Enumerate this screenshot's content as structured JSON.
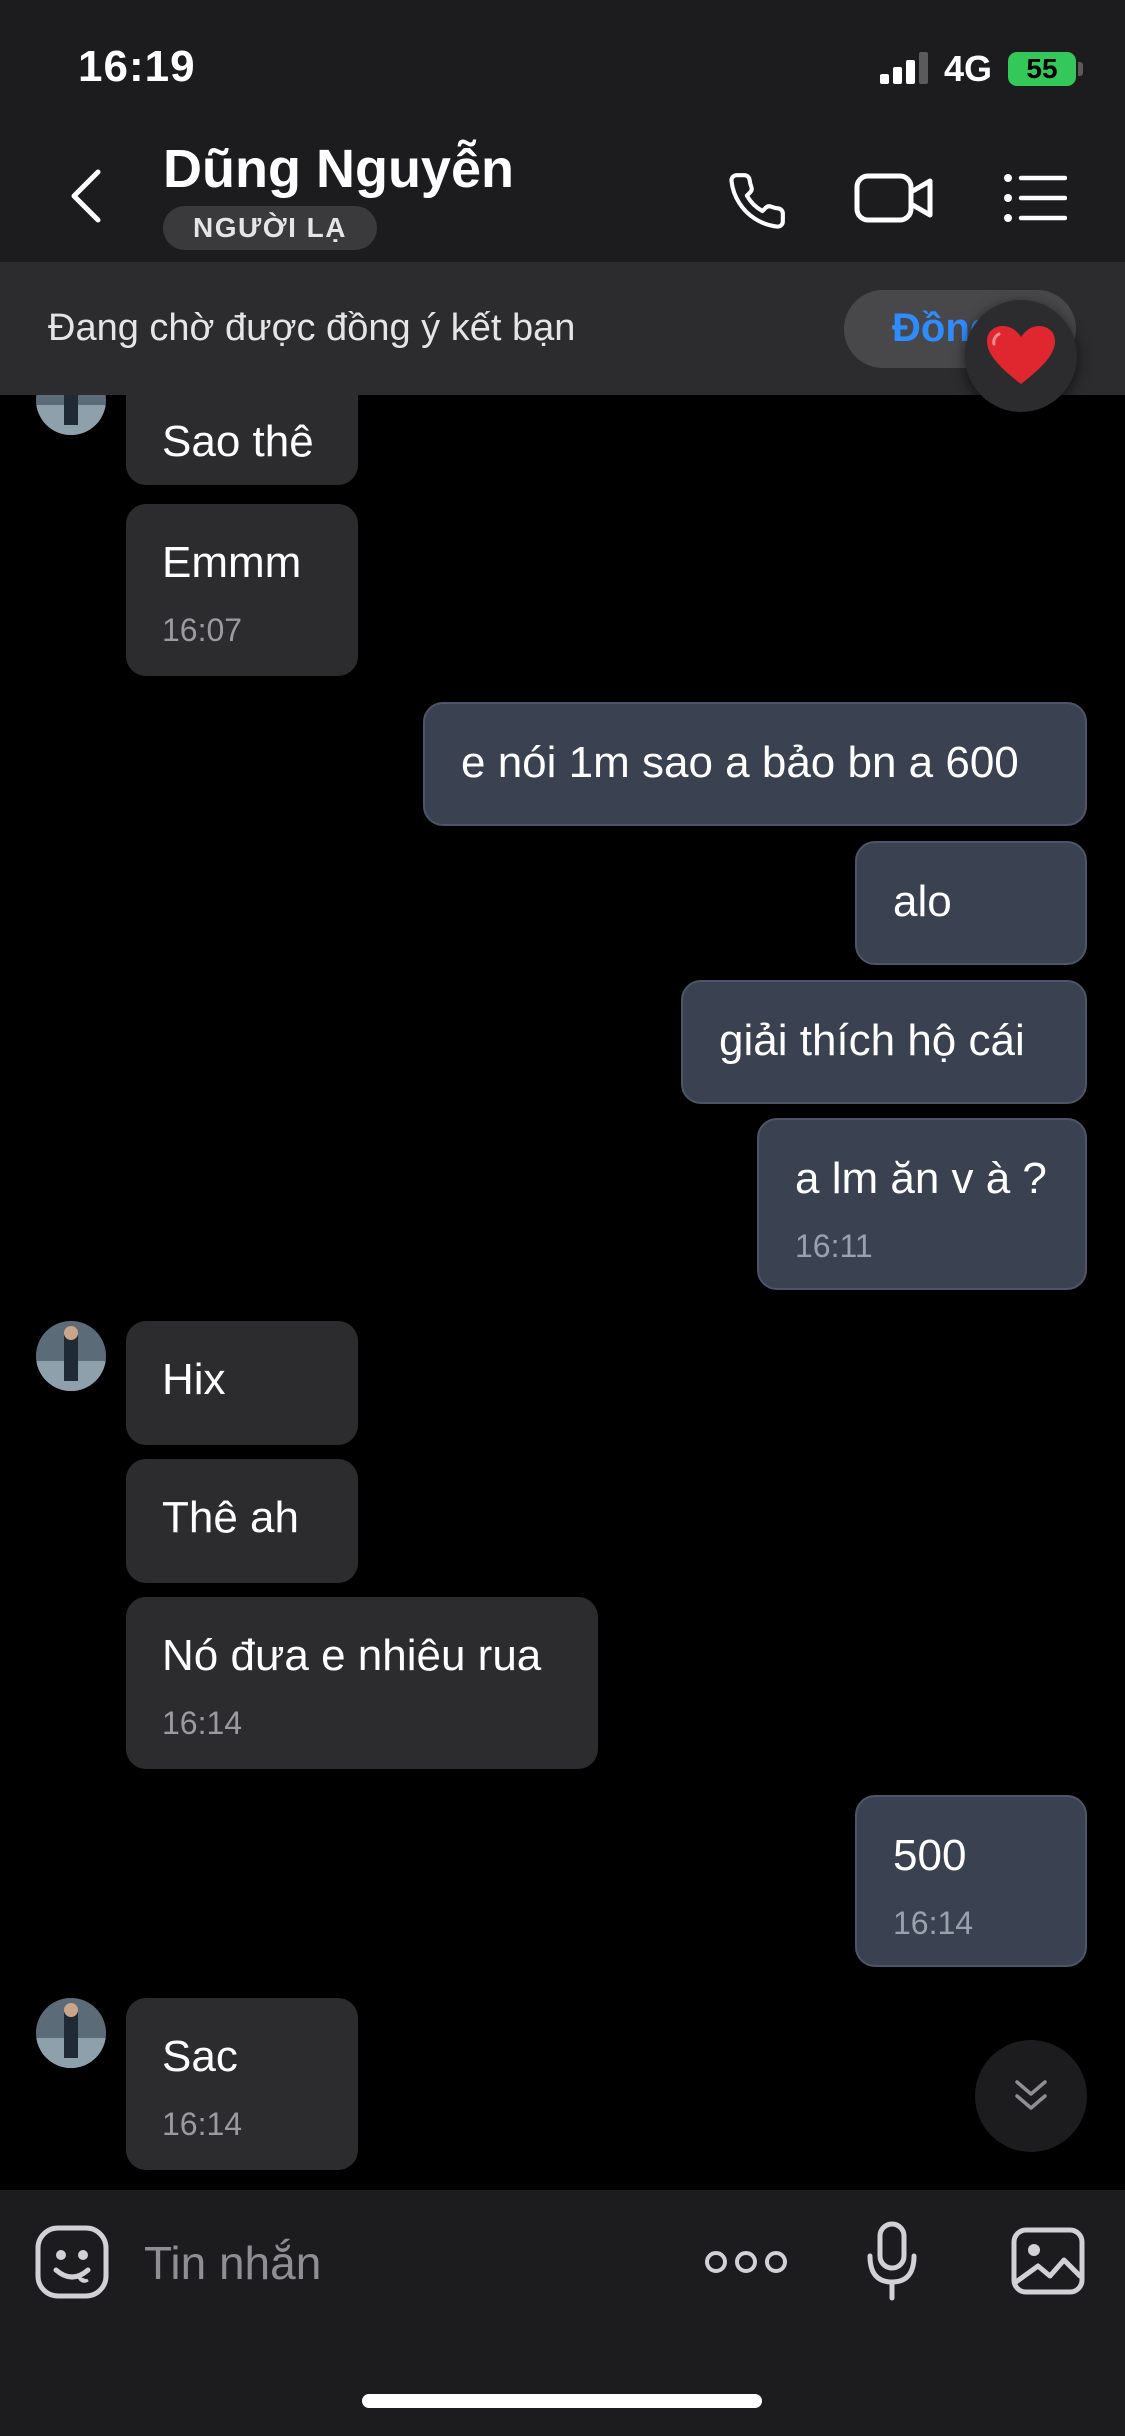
{
  "status_bar": {
    "time": "16:19",
    "network": "4G",
    "battery": "55"
  },
  "header": {
    "contact_name": "Dũng Nguyễn",
    "badge": "NGƯỜI LẠ"
  },
  "pending": {
    "text": "Đang chờ được đồng ý kết bạn",
    "accept_label": "Đồng"
  },
  "reaction": {
    "icon": "heart-icon",
    "color": "#e0262e"
  },
  "messages": [
    {
      "side": "in",
      "text": "Sao thê"
    },
    {
      "side": "in",
      "text": "Emmm",
      "time": "16:07"
    },
    {
      "side": "out",
      "text": "e nói 1m sao a bảo bn a 600"
    },
    {
      "side": "out",
      "text": "alo"
    },
    {
      "side": "out",
      "text": "giải thích hộ cái"
    },
    {
      "side": "out",
      "text": "a lm ăn v à ?",
      "time": "16:11"
    },
    {
      "side": "in",
      "text": "Hix"
    },
    {
      "side": "in",
      "text": "Thê ah"
    },
    {
      "side": "in",
      "text": "Nó đưa e nhiêu rua",
      "time": "16:14"
    },
    {
      "side": "out",
      "text": "500",
      "time": "16:14"
    },
    {
      "side": "in",
      "text": "Sac",
      "time": "16:14"
    }
  ],
  "composer": {
    "placeholder": "Tin nhắn"
  },
  "colors": {
    "accent": "#2f8cff",
    "incoming_bubble": "#2c2c2e",
    "outgoing_bubble": "#3a4150",
    "battery": "#34c759"
  }
}
